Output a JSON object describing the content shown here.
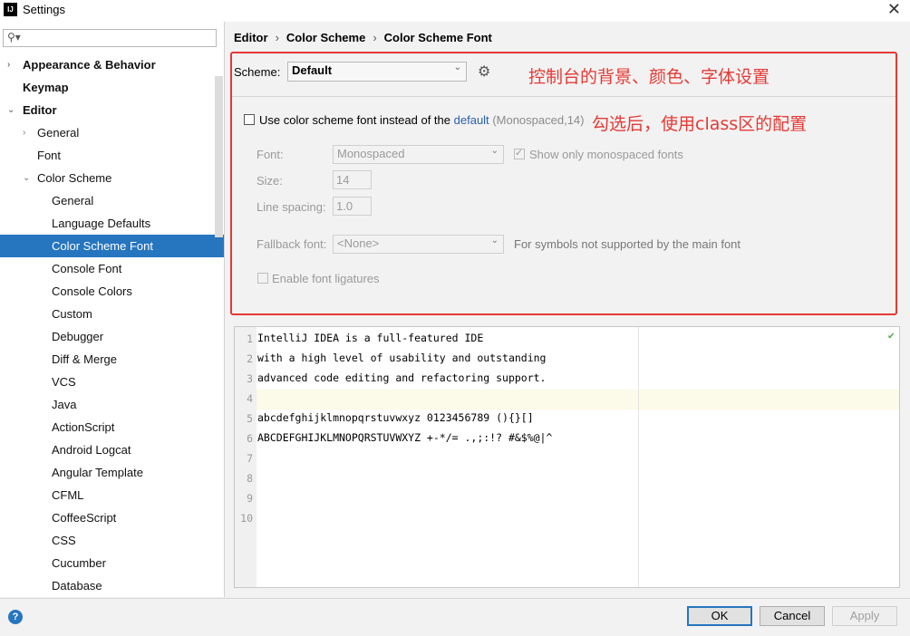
{
  "window": {
    "title": "Settings",
    "app_icon": "IJ"
  },
  "search": {
    "placeholder": ""
  },
  "tree": [
    {
      "label": "Appearance & Behavior",
      "level": 0,
      "bold": true,
      "arrow": "›",
      "selected": false
    },
    {
      "label": "Keymap",
      "level": 0,
      "bold": true,
      "arrow": "",
      "selected": false
    },
    {
      "label": "Editor",
      "level": 0,
      "bold": true,
      "arrow": "⌄",
      "selected": false
    },
    {
      "label": "General",
      "level": 1,
      "bold": false,
      "arrow": "›",
      "selected": false
    },
    {
      "label": "Font",
      "level": 1,
      "bold": false,
      "arrow": "",
      "selected": false
    },
    {
      "label": "Color Scheme",
      "level": 1,
      "bold": false,
      "arrow": "⌄",
      "selected": false
    },
    {
      "label": "General",
      "level": 2,
      "bold": false,
      "arrow": "",
      "selected": false
    },
    {
      "label": "Language Defaults",
      "level": 2,
      "bold": false,
      "arrow": "",
      "selected": false
    },
    {
      "label": "Color Scheme Font",
      "level": 2,
      "bold": false,
      "arrow": "",
      "selected": true
    },
    {
      "label": "Console Font",
      "level": 2,
      "bold": false,
      "arrow": "",
      "selected": false
    },
    {
      "label": "Console Colors",
      "level": 2,
      "bold": false,
      "arrow": "",
      "selected": false
    },
    {
      "label": "Custom",
      "level": 2,
      "bold": false,
      "arrow": "",
      "selected": false
    },
    {
      "label": "Debugger",
      "level": 2,
      "bold": false,
      "arrow": "",
      "selected": false
    },
    {
      "label": "Diff & Merge",
      "level": 2,
      "bold": false,
      "arrow": "",
      "selected": false
    },
    {
      "label": "VCS",
      "level": 2,
      "bold": false,
      "arrow": "",
      "selected": false
    },
    {
      "label": "Java",
      "level": 2,
      "bold": false,
      "arrow": "",
      "selected": false
    },
    {
      "label": "ActionScript",
      "level": 2,
      "bold": false,
      "arrow": "",
      "selected": false
    },
    {
      "label": "Android Logcat",
      "level": 2,
      "bold": false,
      "arrow": "",
      "selected": false
    },
    {
      "label": "Angular Template",
      "level": 2,
      "bold": false,
      "arrow": "",
      "selected": false
    },
    {
      "label": "CFML",
      "level": 2,
      "bold": false,
      "arrow": "",
      "selected": false
    },
    {
      "label": "CoffeeScript",
      "level": 2,
      "bold": false,
      "arrow": "",
      "selected": false
    },
    {
      "label": "CSS",
      "level": 2,
      "bold": false,
      "arrow": "",
      "selected": false
    },
    {
      "label": "Cucumber",
      "level": 2,
      "bold": false,
      "arrow": "",
      "selected": false
    },
    {
      "label": "Database",
      "level": 2,
      "bold": false,
      "arrow": "",
      "selected": false
    }
  ],
  "breadcrumb": {
    "items": [
      "Editor",
      "Color Scheme",
      "Color Scheme Font"
    ],
    "separator": "›"
  },
  "scheme": {
    "label": "Scheme:",
    "value": "Default"
  },
  "annotations": {
    "scheme_note": "控制台的背景、颜色、字体设置",
    "checkbox_note": "勾选后，使用class区的配置"
  },
  "use_scheme_font": {
    "prefix": "Use color scheme font instead of the",
    "link": "default",
    "suffix": "(Monospaced,14)",
    "checked": false
  },
  "font": {
    "label": "Font:",
    "value": "Monospaced",
    "show_mono_label": "Show only monospaced fonts",
    "show_mono_checked": true
  },
  "size": {
    "label": "Size:",
    "value": "14"
  },
  "line_spacing": {
    "label": "Line spacing:",
    "value": "1.0"
  },
  "fallback": {
    "label": "Fallback font:",
    "value": "<None>",
    "note": "For symbols not supported by the main font"
  },
  "ligatures": {
    "label": "Enable font ligatures",
    "checked": false
  },
  "editor": {
    "lines": [
      {
        "num": "1",
        "text": "IntelliJ IDEA is a full-featured IDE"
      },
      {
        "num": "2",
        "text": "with a high level of usability and outstanding"
      },
      {
        "num": "3",
        "text": "advanced code editing and refactoring support."
      },
      {
        "num": "4",
        "text": ""
      },
      {
        "num": "5",
        "text": "abcdefghijklmnopqrstuvwxyz 0123456789 (){}[]"
      },
      {
        "num": "6",
        "text": "ABCDEFGHIJKLMNOPQRSTUVWXYZ +-*/= .,;:!? #&$%@|^"
      },
      {
        "num": "7",
        "text": ""
      },
      {
        "num": "8",
        "text": ""
      },
      {
        "num": "9",
        "text": ""
      },
      {
        "num": "10",
        "text": ""
      }
    ],
    "current_line": "4",
    "status_icon": "check-icon"
  },
  "buttons": {
    "ok": "OK",
    "cancel": "Cancel",
    "apply": "Apply"
  },
  "help": {
    "label": "?"
  },
  "colors": {
    "accent": "#2675bf",
    "annotation": "#e53935",
    "link": "#2a5db0"
  }
}
